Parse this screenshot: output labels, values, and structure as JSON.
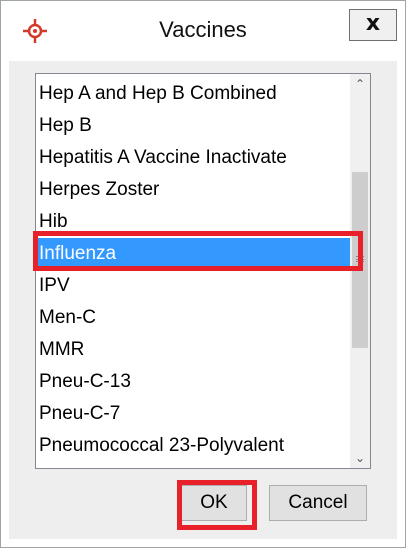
{
  "window": {
    "title": "Vaccines",
    "close_label": "x",
    "app_icon": "crosshair-target-icon"
  },
  "list": {
    "selected_index": 5,
    "items": [
      "Hep A and Hep B Combined",
      "Hep B",
      "Hepatitis A Vaccine Inactivate",
      "Herpes Zoster",
      "Hib",
      "Influenza",
      "IPV",
      "Men-C",
      "MMR",
      "Pneu-C-13",
      "Pneu-C-7",
      "Pneumococcal 23-Polyvalent"
    ]
  },
  "buttons": {
    "ok_label": "OK",
    "cancel_label": "Cancel"
  },
  "colors": {
    "selection": "#3399ff",
    "highlight": "#e8202a",
    "app_icon": "#d23a2a"
  }
}
